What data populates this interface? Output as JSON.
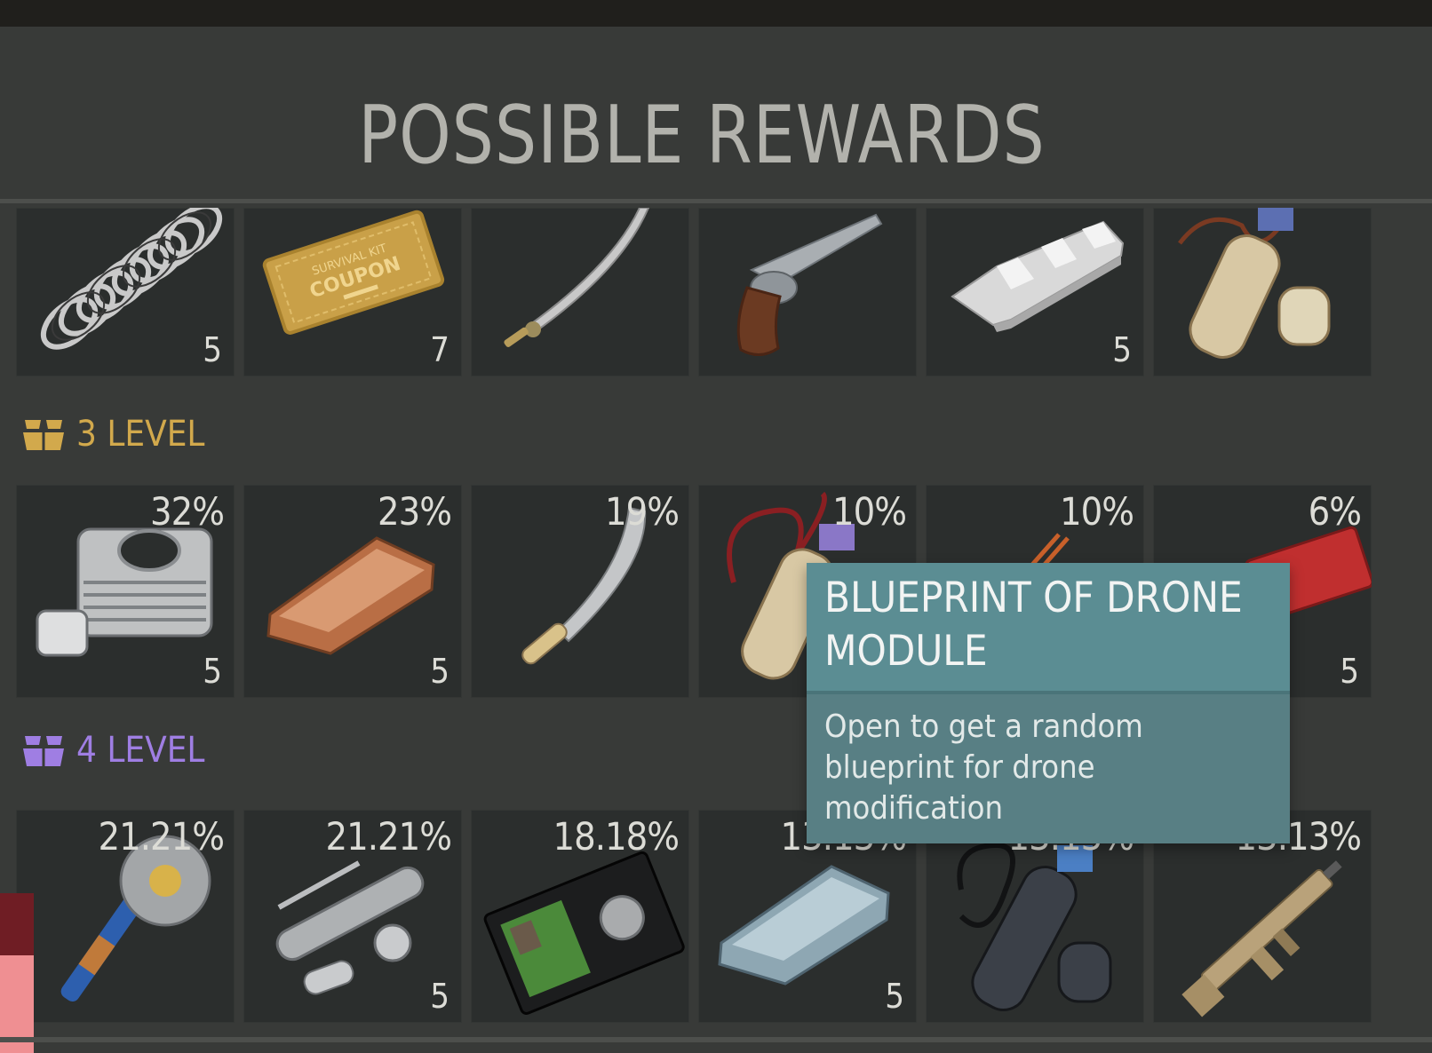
{
  "title": "POSSIBLE REWARDS",
  "top_row": [
    {
      "icon": "spring-icon",
      "qty": "5"
    },
    {
      "icon": "survival-kit-coupon-icon",
      "qty": "7",
      "coupon_text": [
        "SURVIVAL KIT",
        "COUPON"
      ]
    },
    {
      "icon": "saber-icon",
      "qty": ""
    },
    {
      "icon": "revolver-icon",
      "qty": ""
    },
    {
      "icon": "aluminum-ingot-icon",
      "qty": "5"
    },
    {
      "icon": "blueprint-scroll-icon",
      "qty": ""
    }
  ],
  "levels": [
    {
      "label": "3 LEVEL",
      "color": "#d2a94c",
      "items": [
        {
          "icon": "engine-cylinder-icon",
          "pct": "32%",
          "qty": "5"
        },
        {
          "icon": "copper-ingot-icon",
          "pct": "23%",
          "qty": "5"
        },
        {
          "icon": "machete-icon",
          "pct": "19%",
          "qty": ""
        },
        {
          "icon": "drone-blueprint-scroll-icon",
          "pct": "10%",
          "qty": ""
        },
        {
          "icon": "wire-icon",
          "pct": "10%",
          "qty": ""
        },
        {
          "icon": "red-coupon-icon",
          "pct": "6%",
          "qty": "5"
        }
      ]
    },
    {
      "label": "4 LEVEL",
      "color": "#9f7ee3",
      "items": [
        {
          "icon": "saw-club-icon",
          "pct": "21.21%",
          "qty": ""
        },
        {
          "icon": "gun-parts-icon",
          "pct": "21.21%",
          "qty": "5"
        },
        {
          "icon": "police-badge-wallet-icon",
          "pct": "18.18%",
          "qty": ""
        },
        {
          "icon": "steel-ingot-icon",
          "pct": "13.13%",
          "qty": "5"
        },
        {
          "icon": "dark-blueprint-scroll-icon",
          "pct": "13.13%",
          "qty": ""
        },
        {
          "icon": "assault-rifle-icon",
          "pct": "13.13%",
          "qty": ""
        }
      ]
    }
  ],
  "tooltip": {
    "title": "BLUEPRINT OF DRONE MODULE",
    "description": "Open to get a random blueprint for drone modification"
  },
  "colors": {
    "background": "#383a38",
    "cell": "#2b2e2d",
    "tooltip": "#5b8d93",
    "level3": "#d2a94c",
    "level4": "#9f7ee3"
  }
}
